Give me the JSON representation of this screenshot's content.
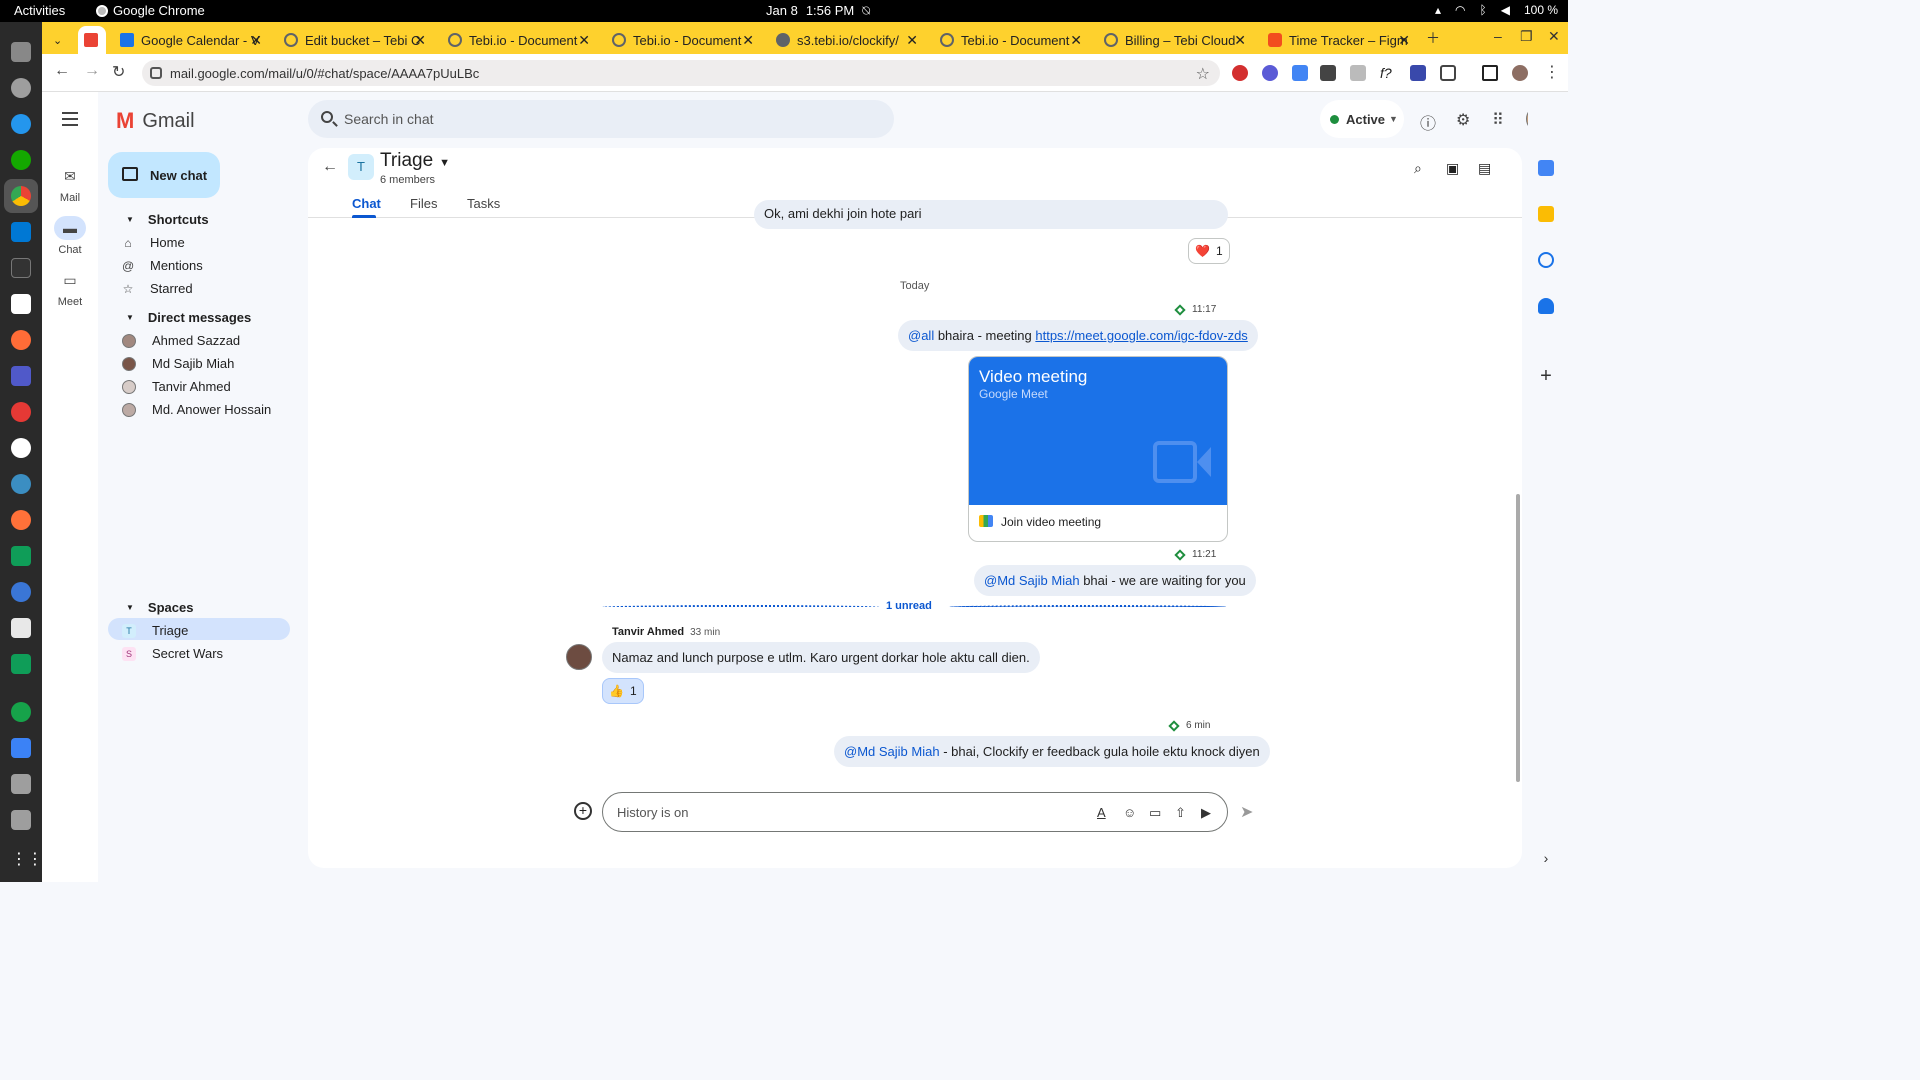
{
  "system_bar": {
    "activities": "Activities",
    "app_name": "Google Chrome",
    "date": "Jan 8",
    "time": "1:56 PM",
    "battery": "100 %"
  },
  "browser": {
    "tabs": [
      {
        "title": "Google Calendar - V",
        "color": "#1a73e8"
      },
      {
        "title": "Edit bucket – Tebi C",
        "color": "#5f6368"
      },
      {
        "title": "Tebi.io - Document",
        "color": "#5f6368"
      },
      {
        "title": "Tebi.io - Document",
        "color": "#5f6368"
      },
      {
        "title": "s3.tebi.io/clockify/",
        "color": "#5f6368"
      },
      {
        "title": "Tebi.io - Document",
        "color": "#5f6368"
      },
      {
        "title": "Billing – Tebi Cloud",
        "color": "#5f6368"
      },
      {
        "title": "Time Tracker – Figm",
        "color": "#f24e1e"
      }
    ],
    "url": "mail.google.com/mail/u/0/#chat/space/AAAA7pUuLBc"
  },
  "gmail": {
    "logo_text": "Gmail",
    "search_placeholder": "Search in chat",
    "status": "Active",
    "rail": [
      {
        "label": "Mail",
        "icon": "mail-icon"
      },
      {
        "label": "Chat",
        "icon": "chat-icon"
      },
      {
        "label": "Meet",
        "icon": "meet-icon"
      }
    ],
    "new_chat": "New chat",
    "shortcuts": {
      "heading": "Shortcuts",
      "items": [
        "Home",
        "Mentions",
        "Starred"
      ]
    },
    "direct_messages": {
      "heading": "Direct messages",
      "items": [
        "Ahmed Sazzad",
        "Md Sajib Miah",
        "Tanvir Ahmed",
        "Md. Anower Hossain"
      ]
    },
    "spaces": {
      "heading": "Spaces",
      "items": [
        {
          "initial": "T",
          "name": "Triage"
        },
        {
          "initial": "S",
          "name": "Secret Wars"
        }
      ]
    }
  },
  "space": {
    "initial": "T",
    "title": "Triage",
    "members": "6 members",
    "tabs": [
      "Chat",
      "Files",
      "Tasks"
    ]
  },
  "messages": {
    "prev_text": "Ok, ami dekhi join hote pari",
    "prev_reaction": {
      "emoji": "❤️",
      "count": "1"
    },
    "day_label": "Today",
    "m1_time": "11:17",
    "m1_mention": "@all",
    "m1_text": " bhaira - meeting ",
    "m1_link": "https://meet.google.com/igc-fdov-zds",
    "card_title": "Video meeting",
    "card_subtitle": "Google Meet",
    "card_action": "Join video meeting",
    "m2_time": "11:21",
    "m2_mention": "@Md Sajib Miah",
    "m2_text": " bhai - we are waiting for you",
    "unread_label": "1 unread",
    "m3_sender": "Tanvir Ahmed",
    "m3_ago": "33 min",
    "m3_text": "Namaz and lunch purpose e utlm. Karo urgent dorkar hole aktu call dien.",
    "m3_reaction": {
      "emoji": "👍",
      "count": "1"
    },
    "m4_time": "6 min",
    "m4_mention": "@Md Sajib Miah",
    "m4_text": " - bhai, Clockify er feedback gula hoile ektu knock diyen"
  },
  "composer": {
    "placeholder": "History is on"
  }
}
